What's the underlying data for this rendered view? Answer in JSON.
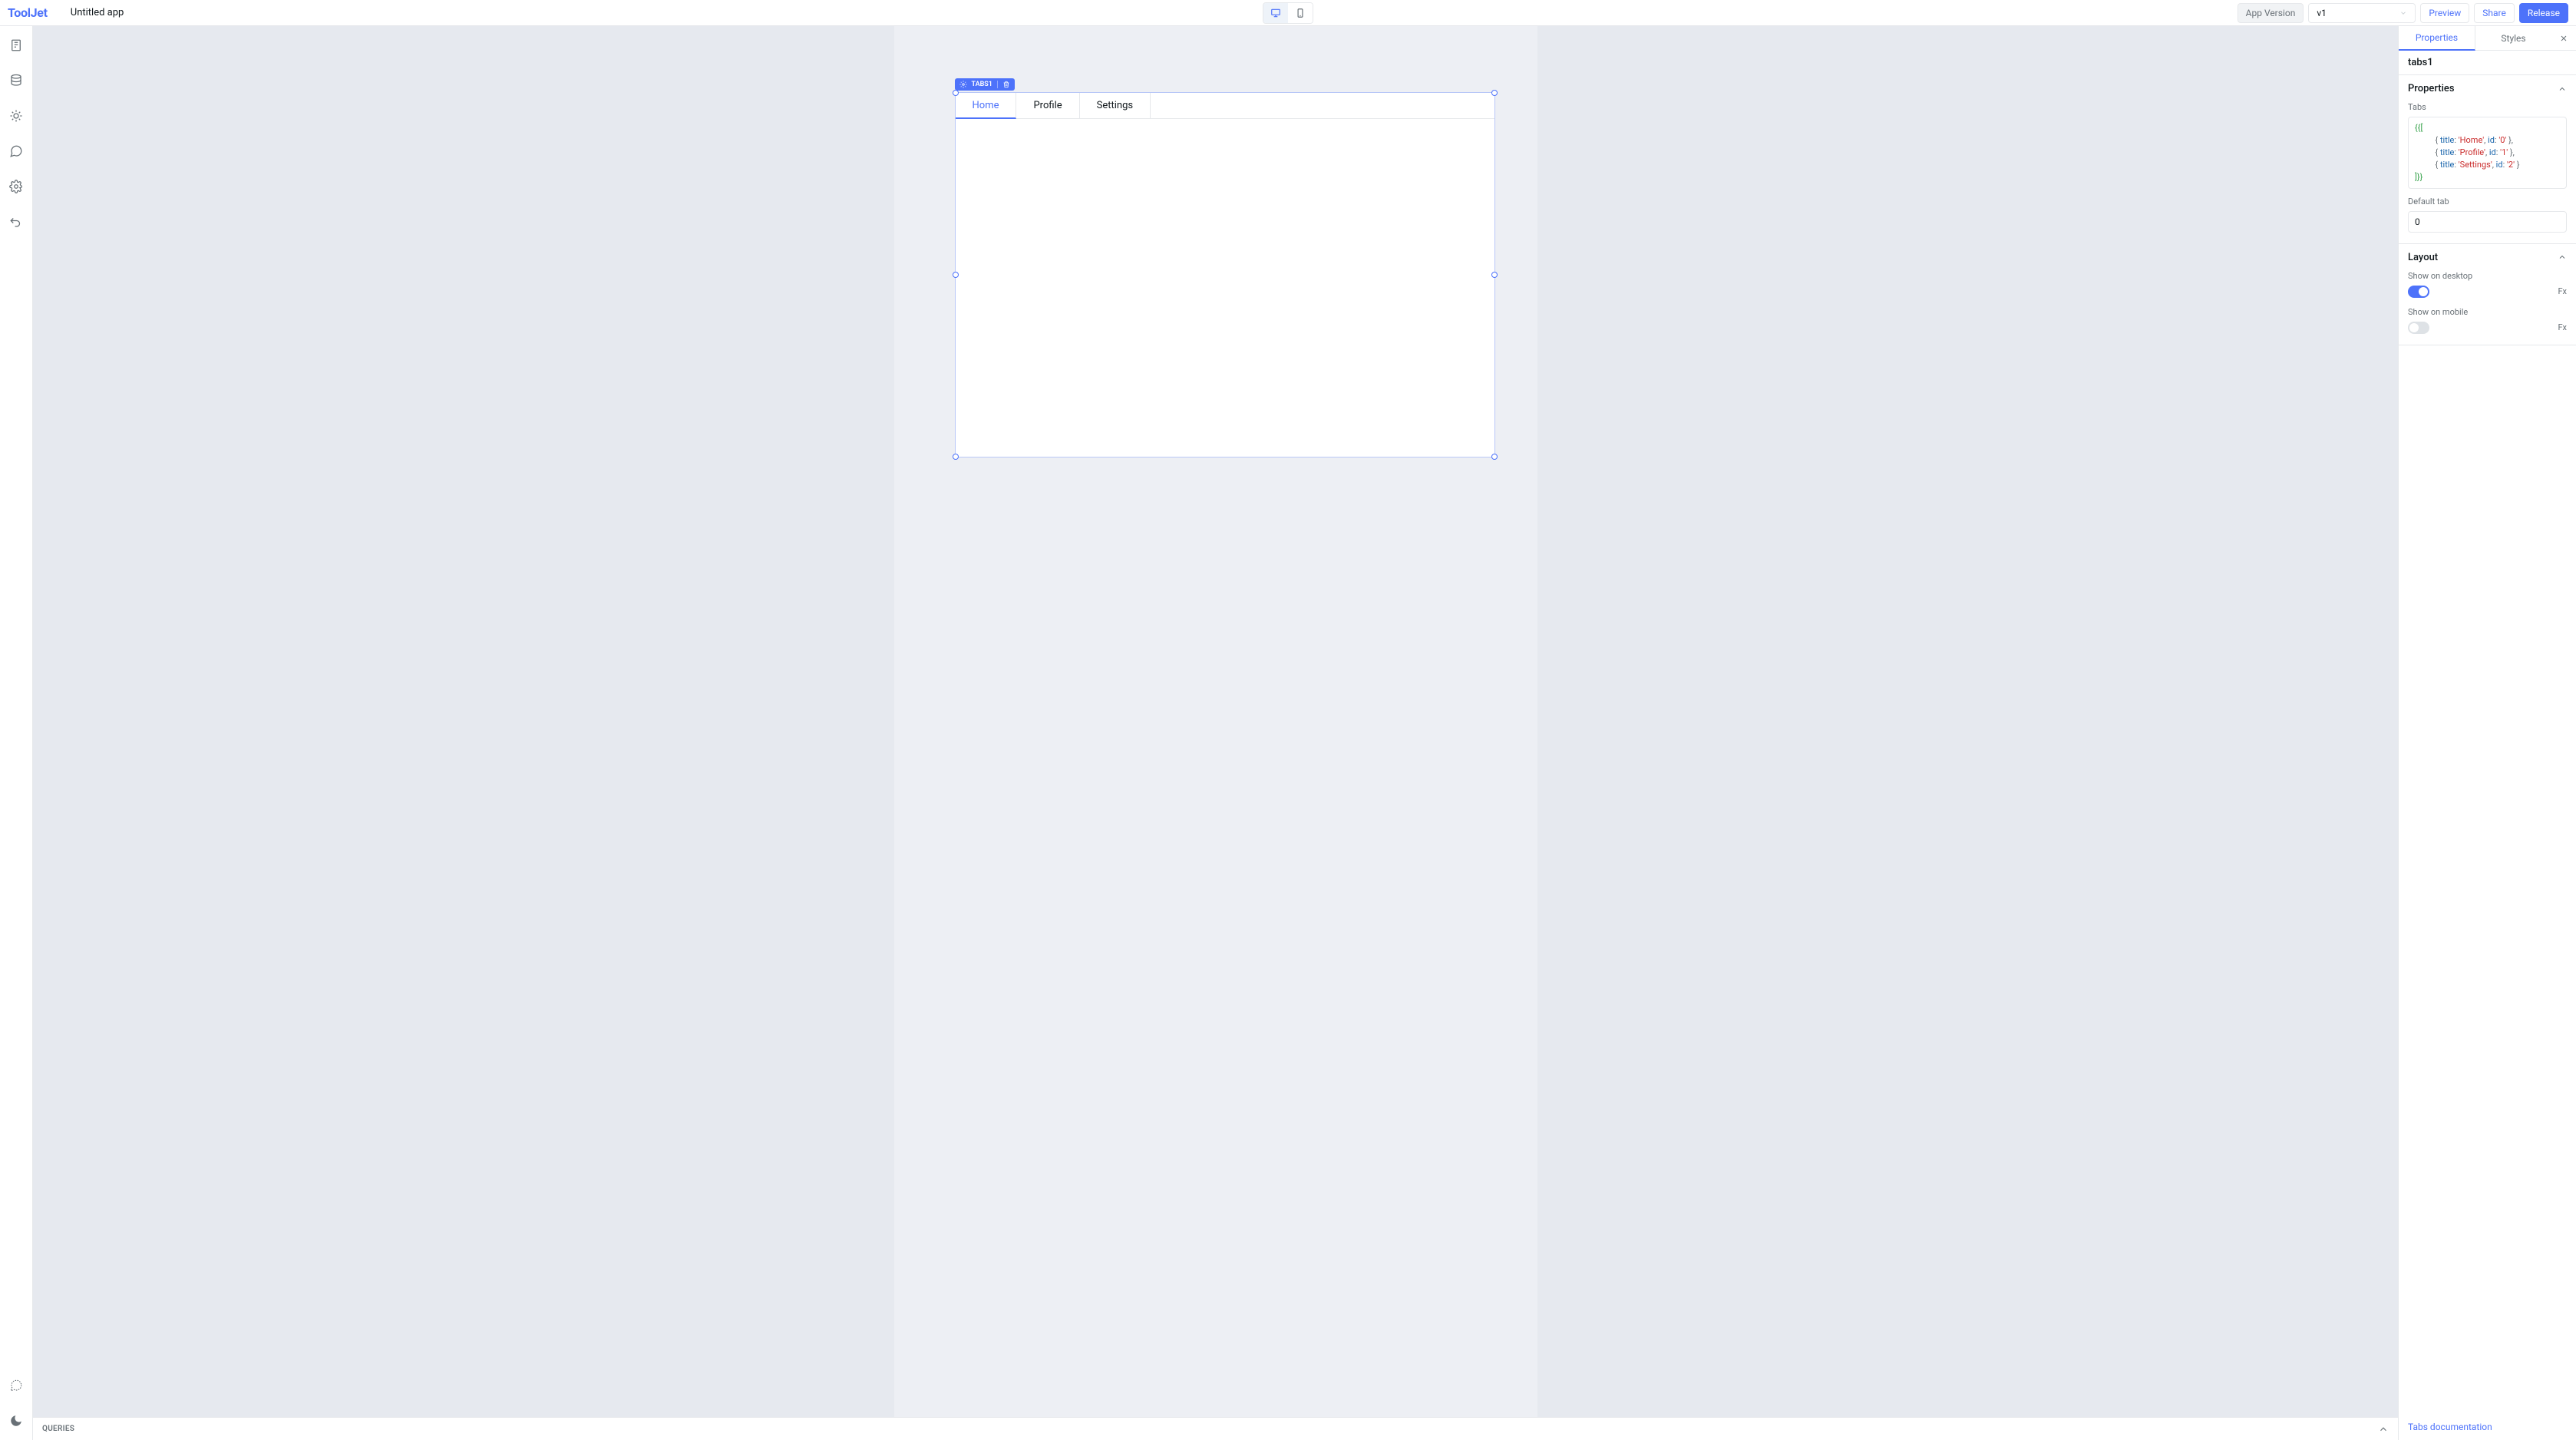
{
  "header": {
    "logo": "ToolJet",
    "app_title": "Untitled app",
    "app_version_label": "App Version",
    "version_value": "v1",
    "preview": "Preview",
    "share": "Share",
    "release": "Release"
  },
  "canvas": {
    "widget_label": "TABS1",
    "tabs": [
      {
        "label": "Home",
        "active": true
      },
      {
        "label": "Profile",
        "active": false
      },
      {
        "label": "Settings",
        "active": false
      }
    ]
  },
  "queries_panel": {
    "title": "QUERIES"
  },
  "right_panel": {
    "tabs": {
      "properties": "Properties",
      "styles": "Styles"
    },
    "component_name": "tabs1",
    "section_properties": "Properties",
    "tabs_label": "Tabs",
    "code_lines": {
      "open": "{{[",
      "l1_title": "title",
      "l1_val": "'Home'",
      "l1_idk": "id",
      "l1_idv": "'0'",
      "l2_title": "title",
      "l2_val": "'Profile'",
      "l2_idk": "id",
      "l2_idv": "'1'",
      "l3_title": "title",
      "l3_val": "'Settings'",
      "l3_idk": "id",
      "l3_idv": "'2'",
      "close": "]}}"
    },
    "default_tab_label": "Default tab",
    "default_tab_value": "0",
    "section_layout": "Layout",
    "show_desktop_label": "Show on desktop",
    "show_mobile_label": "Show on mobile",
    "fx": "Fx",
    "doc_link": "Tabs documentation"
  }
}
